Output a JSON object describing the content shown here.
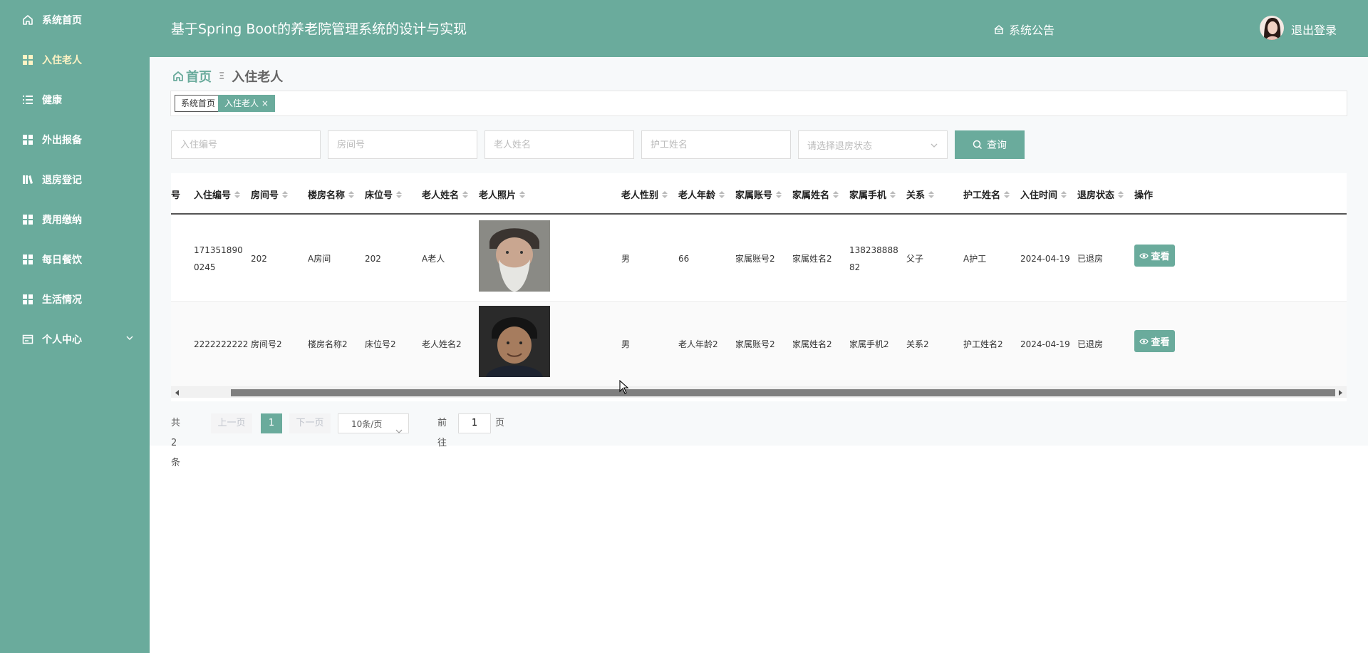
{
  "header": {
    "title": "基于Spring Boot的养老院管理系统的设计与实现",
    "notice_label": "系统公告",
    "logout_label": "退出登录"
  },
  "sidebar": {
    "items": [
      {
        "label": "系统首页",
        "icon": "home-icon"
      },
      {
        "label": "入住老人",
        "icon": "grid-icon",
        "active": true
      },
      {
        "label": "健康",
        "icon": "list-icon"
      },
      {
        "label": "外出报备",
        "icon": "grid-icon"
      },
      {
        "label": "退房登记",
        "icon": "book-icon"
      },
      {
        "label": "费用缴纳",
        "icon": "grid-icon"
      },
      {
        "label": "每日餐饮",
        "icon": "grid-icon"
      },
      {
        "label": "生活情况",
        "icon": "grid-icon"
      },
      {
        "label": "个人中心",
        "icon": "card-icon",
        "expandable": true
      }
    ]
  },
  "breadcrumb": {
    "home": "首页",
    "current": "入住老人"
  },
  "tags": [
    "系统首页",
    "入住老人"
  ],
  "tag_close": "×",
  "search": {
    "placeholders": [
      "入住编号",
      "房间号",
      "老人姓名",
      "护工姓名"
    ],
    "select_placeholder": "请选择退房状态",
    "query_label": "查询"
  },
  "table": {
    "partial_first_header": "号",
    "headers": [
      "入住编号",
      "房间号",
      "楼房名称",
      "床位号",
      "老人姓名",
      "老人照片",
      "老人性别",
      "老人年龄",
      "家属账号",
      "家属姓名",
      "家属手机",
      "关系",
      "护工姓名",
      "入住时间",
      "退房状态",
      "操作"
    ],
    "rows": [
      {
        "id": "1713518900245",
        "room": "202",
        "building": "A房间",
        "bed": "202",
        "name": "A老人",
        "gender": "男",
        "age": "66",
        "family_account": "家属账号2",
        "family_name": "家属姓名2",
        "family_phone": "13823888882",
        "relation": "父子",
        "caregiver": "A护工",
        "checkin": "2024-04-19",
        "status": "已退房",
        "action": "查看"
      },
      {
        "id": "2222222222",
        "room": "房间号2",
        "building": "楼房名称2",
        "bed": "床位号2",
        "name": "老人姓名2",
        "gender": "男",
        "age": "老人年龄2",
        "family_account": "家属账号2",
        "family_name": "家属姓名2",
        "family_phone": "家属手机2",
        "relation": "关系2",
        "caregiver": "护工姓名2",
        "checkin": "2024-04-19",
        "status": "已退房",
        "action": "查看"
      }
    ]
  },
  "pagination": {
    "total": "共 2 条",
    "prev": "上一页",
    "next": "下一页",
    "current_page": "1",
    "page_size": "10条/页",
    "goto_prefix": "前往",
    "goto_value": "1",
    "goto_suffix": "页"
  },
  "colors": {
    "primary": "#6aab9c",
    "active_nav_text": "#fff3c4"
  }
}
